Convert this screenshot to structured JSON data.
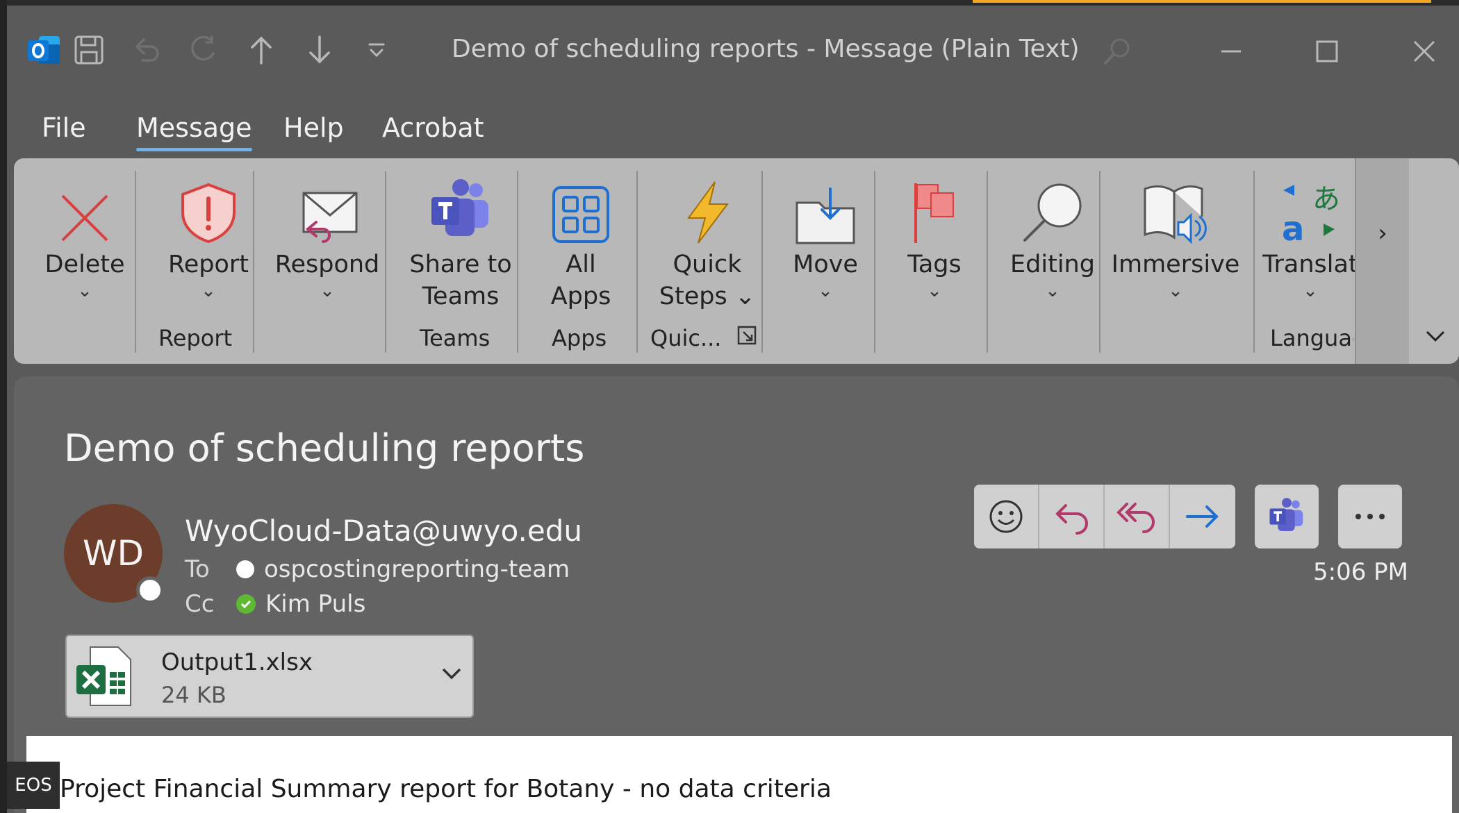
{
  "window": {
    "title": "Demo of scheduling reports  -  Message (Plain Text)"
  },
  "menu": {
    "tabs": [
      {
        "label": "File"
      },
      {
        "label": "Message"
      },
      {
        "label": "Help"
      },
      {
        "label": "Acrobat"
      }
    ]
  },
  "ribbon": {
    "buttons": {
      "delete": "Delete",
      "report": "Report",
      "respond": "Respond",
      "share_teams": "Share to\nTeams",
      "all_apps": "All\nApps",
      "quick_steps": "Quick\nSteps",
      "move": "Move",
      "tags": "Tags",
      "editing": "Editing",
      "immersive": "Immersive",
      "translate": "Translat"
    },
    "groups": {
      "report": "Report",
      "teams": "Teams",
      "apps": "Apps",
      "quick": "Quic...",
      "language": "Languag"
    }
  },
  "message": {
    "subject": "Demo of scheduling reports",
    "avatar_initials": "WD",
    "sender": "WyoCloud-Data@uwyo.edu",
    "to_label": "To",
    "to": "ospcostingreporting-team",
    "cc_label": "Cc",
    "cc": "Kim Puls",
    "time": "5:06 PM",
    "attachment": {
      "name": "Output1.xlsx",
      "size": "24 KB"
    },
    "body": "Project Financial Summary report for Botany - no data criteria"
  },
  "overlay": {
    "badge": "EOS"
  },
  "colors": {
    "accent": "#6fb2f2",
    "avatar": "#6b3d2a",
    "presence_green": "#5fb832",
    "excel_green": "#1d6f42",
    "teams_purple": "#5b5fc7"
  }
}
